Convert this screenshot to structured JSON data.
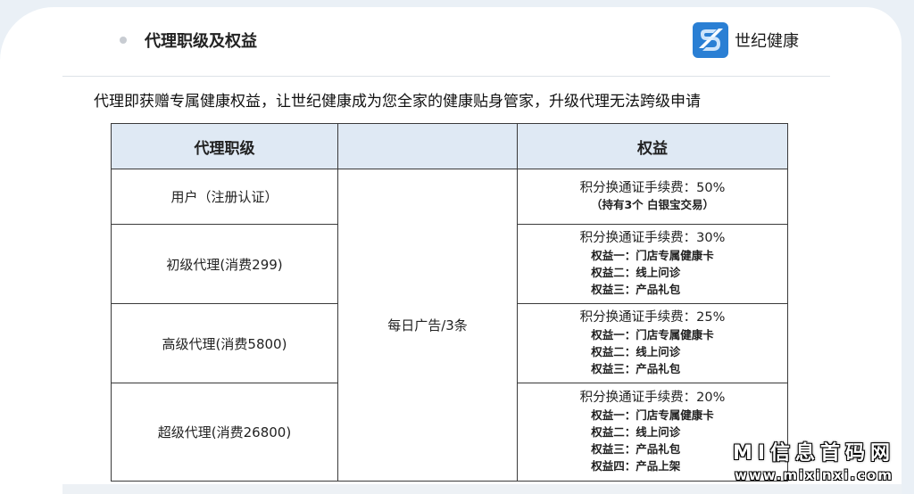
{
  "header": {
    "title": "代理职级及权益",
    "brand_name": "世纪健康"
  },
  "subtitle": "代理即获赠专属健康权益，让世纪健康成为您全家的健康贴身管家，升级代理无法跨级申请",
  "table": {
    "headers": [
      "代理职级",
      "",
      "权益"
    ],
    "ad_text": "每日广告/3条",
    "rows": [
      {
        "level": "用户（注册认证）",
        "fee": "积分换通证手续费：50%",
        "note": "（持有3个 白银宝交易）",
        "benefits": []
      },
      {
        "level": "初级代理(消费299)",
        "fee": "积分换通证手续费：30%",
        "note": "",
        "benefits": [
          "权益一：门店专属健康卡",
          "权益二：线上问诊",
          "权益三：产品礼包"
        ]
      },
      {
        "level": "高级代理(消费5800)",
        "fee": "积分换通证手续费：25%",
        "note": "",
        "benefits": [
          "权益一：门店专属健康卡",
          "权益二：线上问诊",
          "权益三：产品礼包"
        ]
      },
      {
        "level": "超级代理(消费26800)",
        "fee": "积分换通证手续费：20%",
        "note": "",
        "benefits": [
          "权益一：门店专属健康卡",
          "权益二：线上问诊",
          "权益三：产品礼包",
          "权益四：产品上架"
        ]
      }
    ]
  },
  "watermark": {
    "title": "MI信息首码网",
    "url": "www.mixinxi.com"
  },
  "colors": {
    "header_bg": "#dfe9f4",
    "logo_blue": "#2a7fd4",
    "border": "#3a3a3a"
  }
}
